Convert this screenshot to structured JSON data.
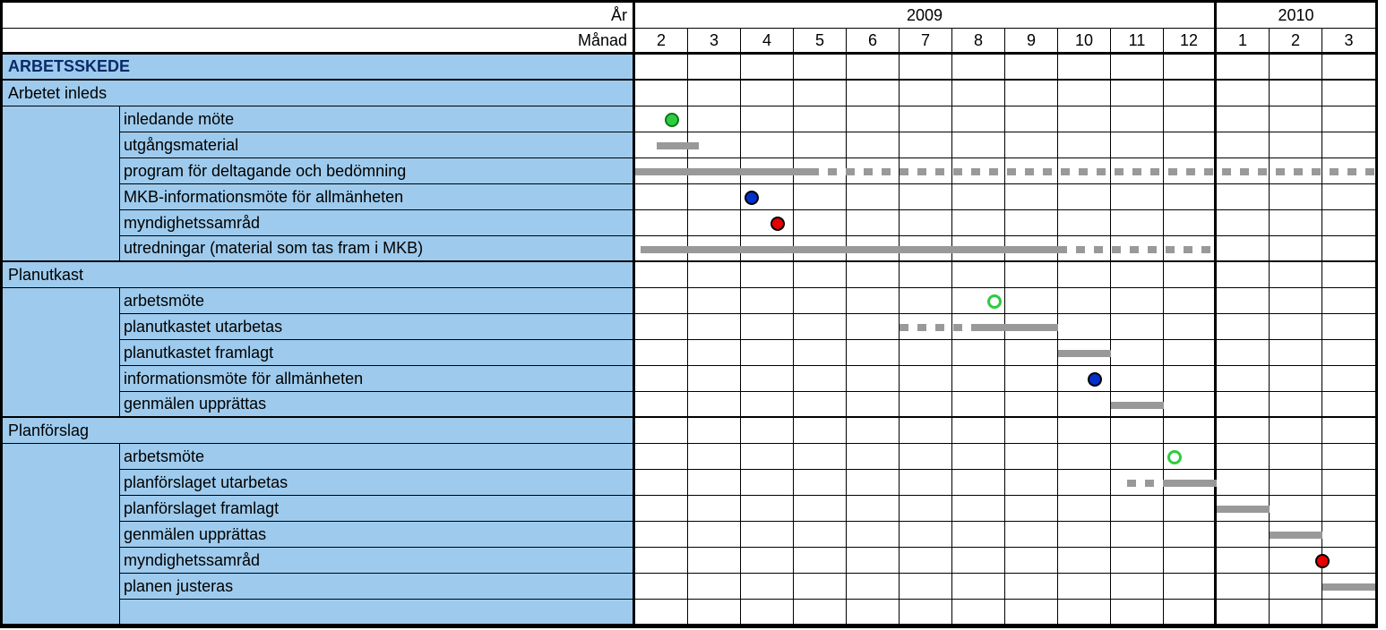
{
  "chart_data": {
    "type": "table",
    "title": "",
    "header": {
      "year": "År",
      "month": "Månad"
    },
    "years": [
      {
        "label": "2009",
        "span": 11,
        "months": [
          2,
          3,
          4,
          5,
          6,
          7,
          8,
          9,
          10,
          11,
          12
        ]
      },
      {
        "label": "2010",
        "span": 3,
        "months": [
          1,
          2,
          3
        ]
      }
    ],
    "total_months": 14,
    "section_label": "ARBETSSKEDE",
    "groups": [
      {
        "label": "Arbetet inleds",
        "tasks": [
          {
            "label": "inledande möte",
            "items": [
              {
                "kind": "dot",
                "color": "green",
                "at": 0.7
              }
            ]
          },
          {
            "label": "utgångsmaterial",
            "items": [
              {
                "kind": "bar",
                "from": 0.4,
                "to": 1.2
              }
            ]
          },
          {
            "label": "program för deltagande och bedömning",
            "items": [
              {
                "kind": "bar",
                "from": 0.0,
                "to": 3.3
              },
              {
                "kind": "bar",
                "style": "dotted",
                "from": 3.3,
                "to": 14.0
              }
            ]
          },
          {
            "label": "MKB-informationsmöte för allmänheten",
            "items": [
              {
                "kind": "dot",
                "color": "blue",
                "at": 2.2
              }
            ]
          },
          {
            "label": "myndighetssamråd",
            "items": [
              {
                "kind": "dot",
                "color": "red",
                "at": 2.7
              }
            ]
          },
          {
            "label": "utredningar (material som tas fram i MKB)",
            "items": [
              {
                "kind": "bar",
                "from": 0.1,
                "to": 8.0
              },
              {
                "kind": "bar",
                "style": "dotted",
                "from": 8.0,
                "to": 11.0
              }
            ]
          }
        ]
      },
      {
        "label": "Planutkast",
        "tasks": [
          {
            "label": "arbetsmöte",
            "items": [
              {
                "kind": "dot",
                "color": "green-open",
                "at": 6.8
              }
            ]
          },
          {
            "label": "planutkastet utarbetas",
            "items": [
              {
                "kind": "bar",
                "style": "dotted",
                "from": 5.0,
                "to": 6.5
              },
              {
                "kind": "bar",
                "from": 6.5,
                "to": 8.0
              }
            ]
          },
          {
            "label": "planutkastet framlagt",
            "items": [
              {
                "kind": "bar",
                "from": 8.0,
                "to": 9.0
              }
            ]
          },
          {
            "label": "informationsmöte för allmänheten",
            "items": [
              {
                "kind": "dot",
                "color": "blue",
                "at": 8.7
              }
            ]
          },
          {
            "label": "genmälen upprättas",
            "items": [
              {
                "kind": "bar",
                "from": 9.0,
                "to": 10.0
              }
            ]
          }
        ]
      },
      {
        "label": "Planförslag",
        "tasks": [
          {
            "label": "arbetsmöte",
            "items": [
              {
                "kind": "dot",
                "color": "green-open",
                "at": 10.2
              }
            ]
          },
          {
            "label": "planförslaget utarbetas",
            "items": [
              {
                "kind": "bar",
                "style": "dotted",
                "from": 9.3,
                "to": 10.0
              },
              {
                "kind": "bar",
                "from": 10.0,
                "to": 11.0
              }
            ]
          },
          {
            "label": "planförslaget framlagt",
            "items": [
              {
                "kind": "bar",
                "from": 11.0,
                "to": 12.0
              }
            ]
          },
          {
            "label": "genmälen upprättas",
            "items": [
              {
                "kind": "bar",
                "from": 12.0,
                "to": 13.0
              }
            ]
          },
          {
            "label": "myndighetssamråd",
            "items": [
              {
                "kind": "dot",
                "color": "red",
                "at": 13.0
              }
            ]
          },
          {
            "label": "planen justeras",
            "items": [
              {
                "kind": "bar",
                "from": 13.0,
                "to": 14.0
              }
            ]
          },
          {
            "label": "",
            "items": []
          }
        ]
      }
    ]
  }
}
